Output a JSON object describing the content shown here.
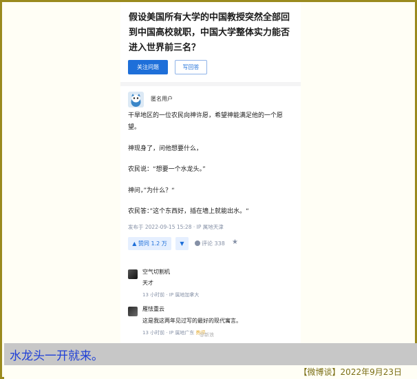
{
  "question": {
    "title": "假设美国所有大学的中国教授突然全部回到中国高校就职，中国大学整体实力能否进入世界前三名？",
    "follow_label": "关注问题",
    "answer_label": "写回答"
  },
  "answer": {
    "author": "匿名用户",
    "paragraphs": [
      "干旱地区的一位农民向神许愿，希望神能满足他的一个愿望。",
      "神现身了，问他想要什么，",
      "农民说：“想要一个水龙头。”",
      "神问，”为什么？“",
      "农民答：”这个东西好，插在墙上就能出水。“"
    ],
    "meta": "发布于 2022-09-15 15:28 · IP 属地天津",
    "vote_label": "▲ 赞同 1.2 万",
    "downvote_label": "▼",
    "comment_label": "评论 338",
    "star_icon": "★"
  },
  "comments": [
    {
      "name": "空气切割机",
      "text": "天才",
      "meta": "13 小时前 · IP 属地加拿大",
      "hot": ""
    },
    {
      "name": "雁怯重云",
      "text": "这是我这两年见过写的最好的现代寓言。",
      "meta": "13 小时前 · IP 属地广东",
      "hot": "热评"
    }
  ],
  "watermark": "@新浪",
  "caption": "水龙头一开就来。",
  "footer": "【微博谈】2022年9月23日",
  "colors": {
    "accent": "#1e6fd9",
    "frame": "#9a8a1e",
    "caption_text": "#1f3fd6",
    "caption_bg": "#c7c7c7"
  }
}
